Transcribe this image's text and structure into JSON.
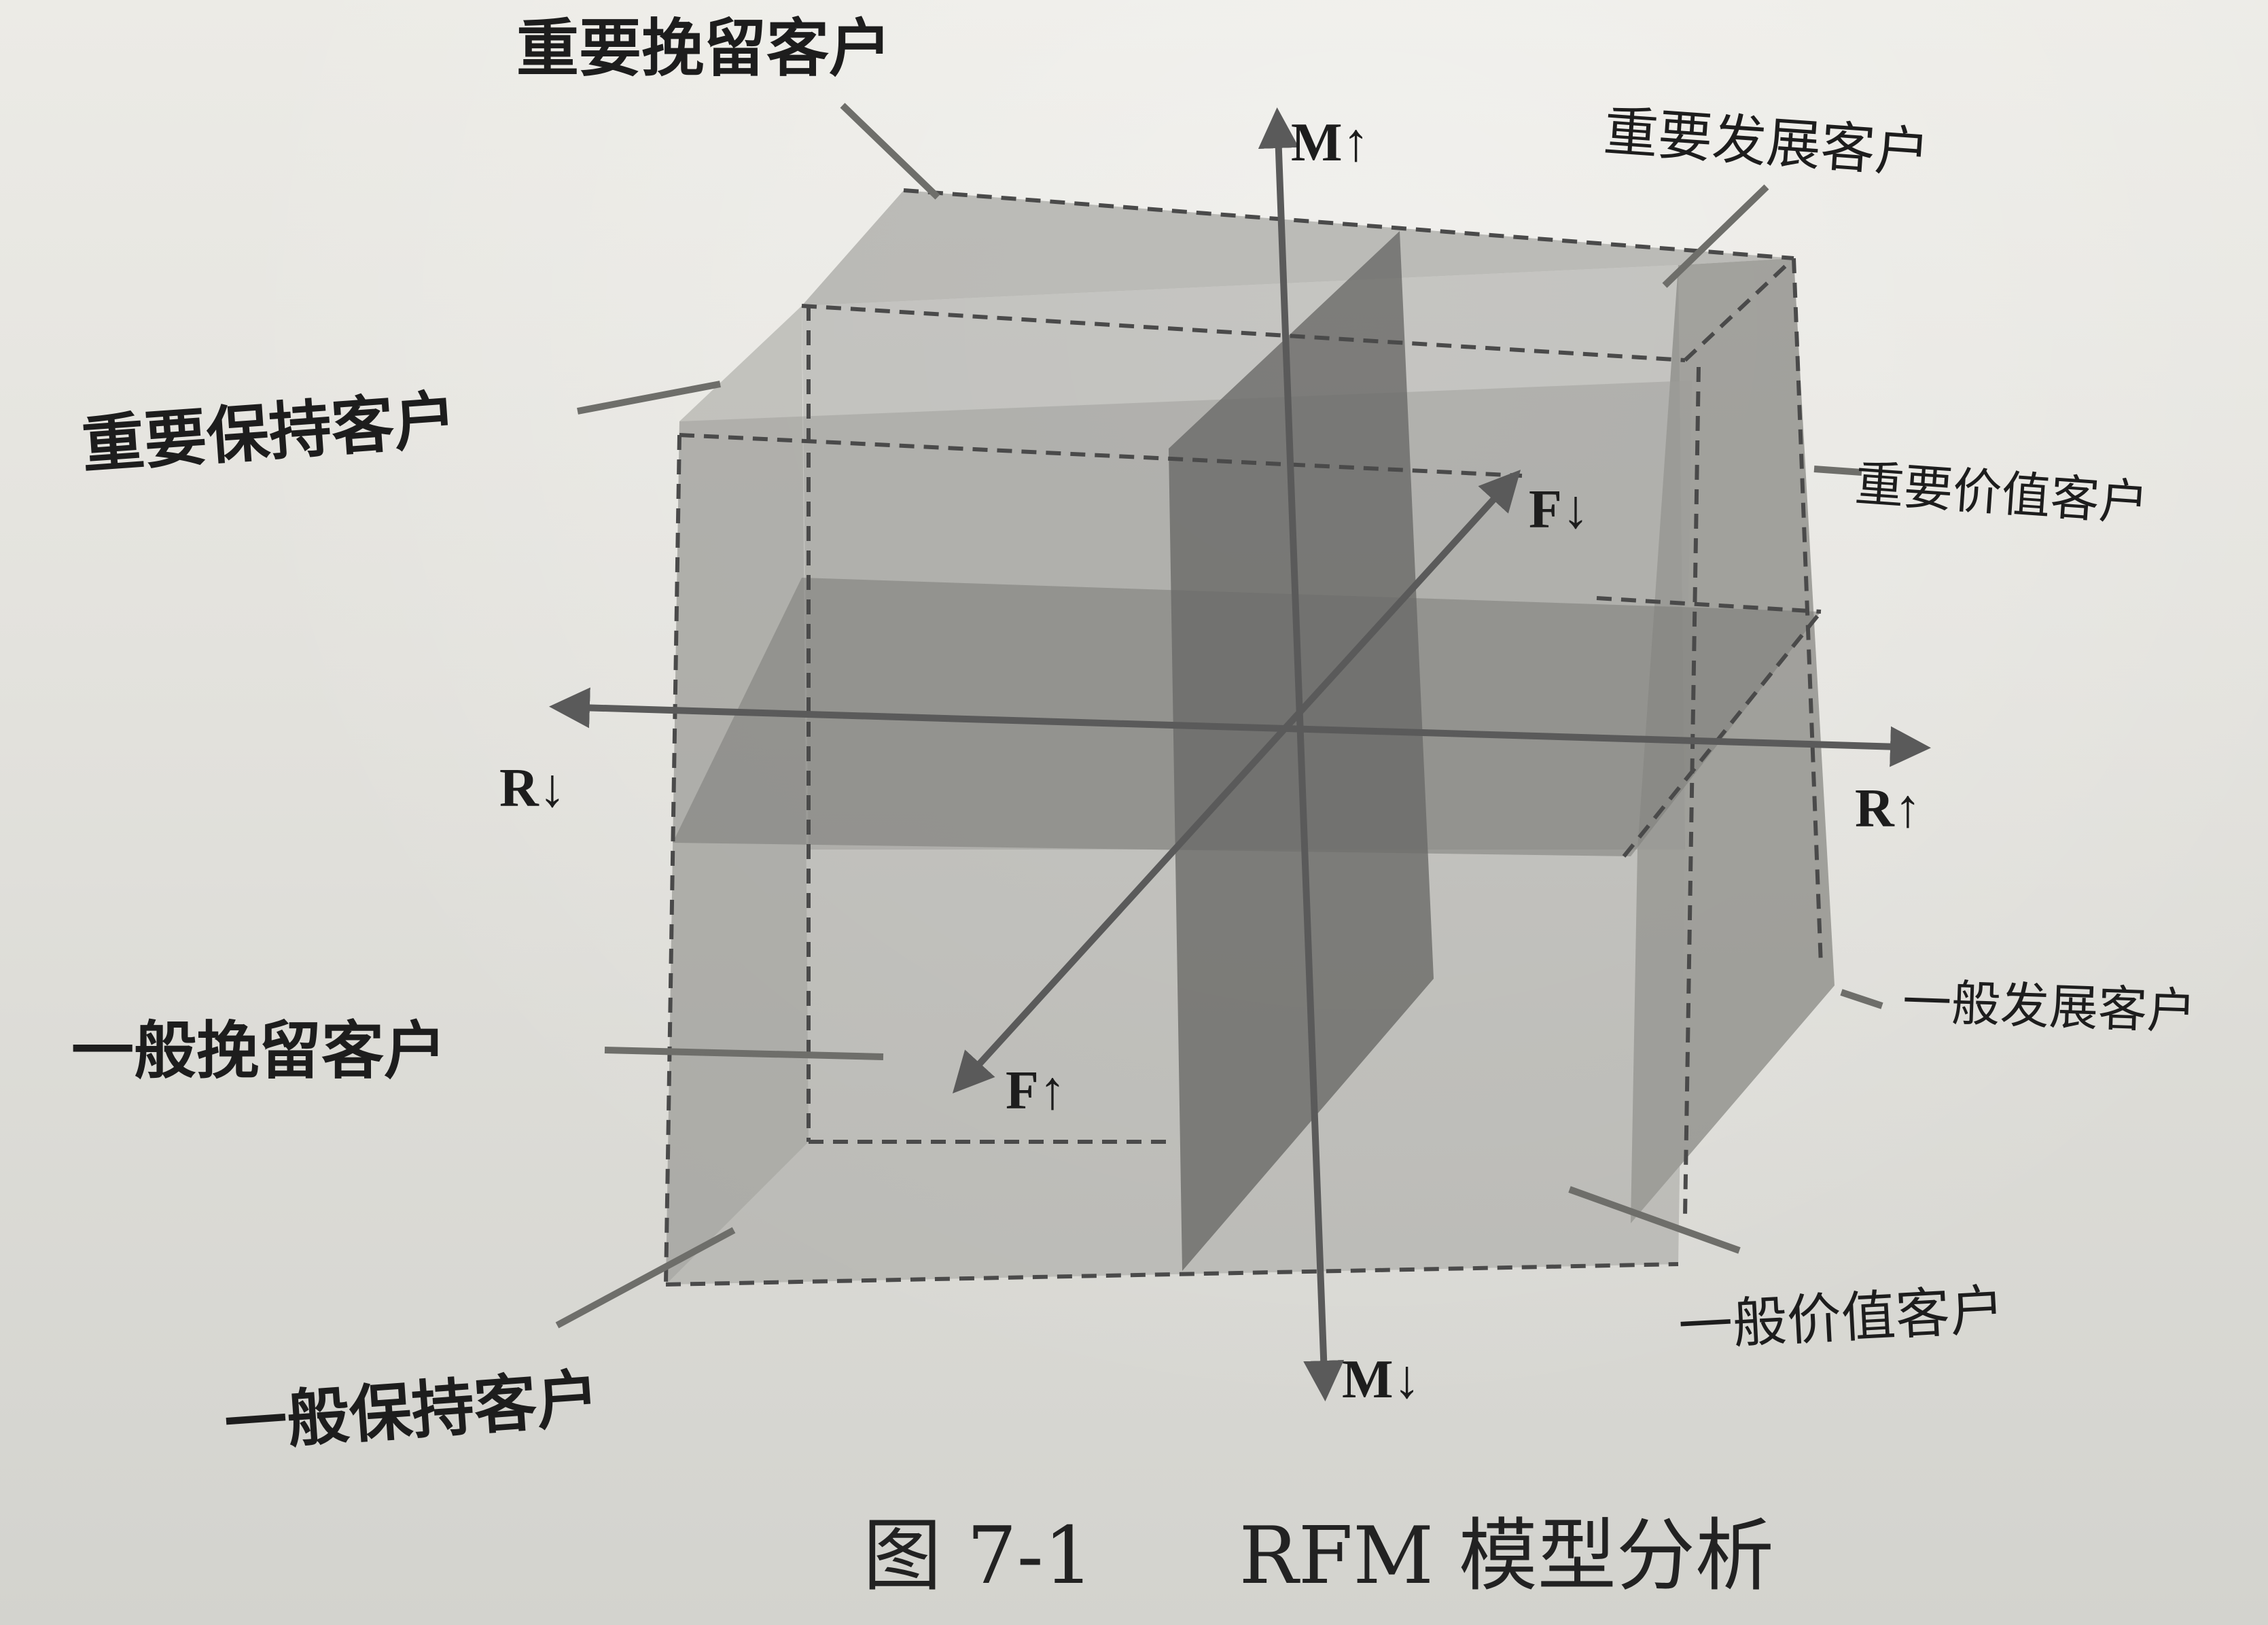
{
  "labels": {
    "important_retain": "重要挽留客户",
    "important_develop": "重要发展客户",
    "important_keep": "重要保持客户",
    "important_value": "重要价值客户",
    "general_retain": "一般挽留客户",
    "general_develop": "一般发展客户",
    "general_keep": "一般保持客户",
    "general_value": "一般价值客户"
  },
  "axes": {
    "m_up": "M↑",
    "m_down": "M↓",
    "r_down": "R↓",
    "r_up": "R↑",
    "f_down": "F↓",
    "f_up": "F↑"
  },
  "caption": {
    "number": "图 7-1",
    "title": "RFM 模型分析"
  },
  "colors": {
    "ink": "#1d1d1d",
    "cube_front": "#9a9a96",
    "cube_side": "#8a8a86",
    "plane_dark": "#6a6a68",
    "axis": "#5a5a5a"
  }
}
